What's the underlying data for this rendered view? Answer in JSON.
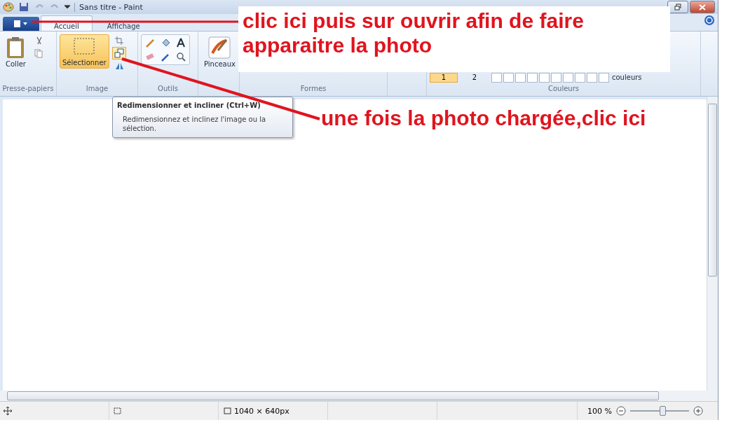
{
  "window": {
    "title": "Sans titre - Paint"
  },
  "tabs": [
    {
      "label": "Accueil",
      "selected": true
    },
    {
      "label": "Affichage",
      "selected": false
    }
  ],
  "ribbon": {
    "clipboard": {
      "label": "Presse-papiers",
      "paste": "Coller"
    },
    "image": {
      "label": "Image",
      "select": "Sélectionner"
    },
    "tools": {
      "label": "Outils"
    },
    "brushes": {
      "label": "Pinceaux"
    },
    "shapes": {
      "label": "Formes"
    },
    "colors": {
      "label": "Couleurs",
      "color_1": "1",
      "color_2": "2",
      "edit": "couleurs"
    }
  },
  "tooltip": {
    "title": "Redimensionner et incliner (Ctrl+W)",
    "text": "Redimensionnez et inclinez l'image ou la sélection."
  },
  "status_bar": {
    "dimensions": "1040 × 640px",
    "zoom": "100 %",
    "zoom_slider": {
      "level": 0.55
    }
  },
  "annotations": [
    {
      "kind": "boxed",
      "text": "clic ici puis sur ouvrir afin de faire apparaitre la photo"
    },
    {
      "kind": "plain",
      "text": "une fois la photo chargée,clic ici"
    }
  ]
}
